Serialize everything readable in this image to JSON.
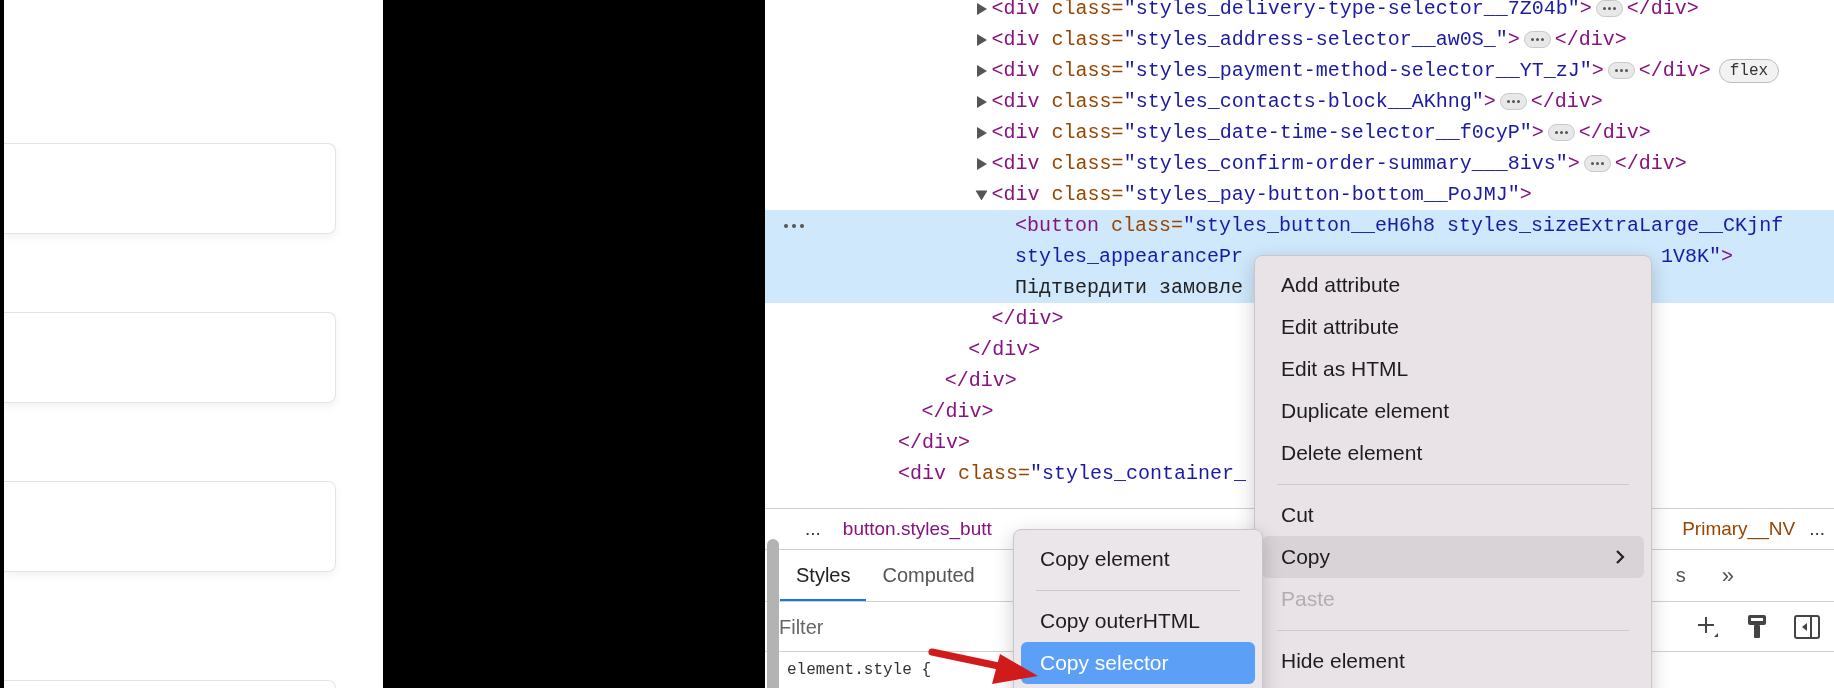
{
  "elements_tree": {
    "nodes": [
      {
        "children": [
          {
            "children": [
              {
                "children": [
                  {
                    "children": [
                      {
                        "selected": false,
                        "expanded": false,
                        "open": [
                          {
                            "kind": "tag",
                            "text": "<div"
                          },
                          {
                            "kind": "attr",
                            "text": " class="
                          },
                          {
                            "kind": "value",
                            "text": "\"styles_delivery-type-selector__7Z04b\""
                          },
                          {
                            "kind": "tag",
                            "text": ">"
                          }
                        ],
                        "ellipsis": true,
                        "tail": [
                          {
                            "kind": "tag",
                            "text": "</div>"
                          }
                        ]
                      },
                      {
                        "selected": false,
                        "expanded": false,
                        "open": [
                          {
                            "kind": "tag",
                            "text": "<div"
                          },
                          {
                            "kind": "attr",
                            "text": " class="
                          },
                          {
                            "kind": "value",
                            "text": "\"styles_address-selector__aw0S_\""
                          },
                          {
                            "kind": "tag",
                            "text": ">"
                          }
                        ],
                        "ellipsis": true,
                        "tail": [
                          {
                            "kind": "tag",
                            "text": "</div>"
                          }
                        ]
                      },
                      {
                        "selected": false,
                        "expanded": false,
                        "open": [
                          {
                            "kind": "tag",
                            "text": "<div"
                          },
                          {
                            "kind": "attr",
                            "text": " class="
                          },
                          {
                            "kind": "value",
                            "text": "\"styles_payment-method-selector__YT_zJ\""
                          },
                          {
                            "kind": "tag",
                            "text": ">"
                          }
                        ],
                        "ellipsis": true,
                        "tail": [
                          {
                            "kind": "tag",
                            "text": "</div>"
                          }
                        ],
                        "badge": "flex"
                      },
                      {
                        "selected": false,
                        "expanded": false,
                        "open": [
                          {
                            "kind": "tag",
                            "text": "<div"
                          },
                          {
                            "kind": "attr",
                            "text": " class="
                          },
                          {
                            "kind": "value",
                            "text": "\"styles_contacts-block__AKhng\""
                          },
                          {
                            "kind": "tag",
                            "text": ">"
                          }
                        ],
                        "ellipsis": true,
                        "tail": [
                          {
                            "kind": "tag",
                            "text": "</div>"
                          }
                        ]
                      },
                      {
                        "selected": false,
                        "expanded": false,
                        "open": [
                          {
                            "kind": "tag",
                            "text": "<div"
                          },
                          {
                            "kind": "attr",
                            "text": " class="
                          },
                          {
                            "kind": "value",
                            "text": "\"styles_date-time-selector__f0cyP\""
                          },
                          {
                            "kind": "tag",
                            "text": ">"
                          }
                        ],
                        "ellipsis": true,
                        "tail": [
                          {
                            "kind": "tag",
                            "text": "</div>"
                          }
                        ]
                      },
                      {
                        "selected": false,
                        "expanded": false,
                        "open": [
                          {
                            "kind": "tag",
                            "text": "<div"
                          },
                          {
                            "kind": "attr",
                            "text": " class="
                          },
                          {
                            "kind": "value",
                            "text": "\"styles_confirm-order-summary___8ivs\""
                          },
                          {
                            "kind": "tag",
                            "text": ">"
                          }
                        ],
                        "ellipsis": true,
                        "tail": [
                          {
                            "kind": "tag",
                            "text": "</div>"
                          }
                        ]
                      },
                      {
                        "selected": false,
                        "expanded": true,
                        "open": [
                          {
                            "kind": "tag",
                            "text": "<div"
                          },
                          {
                            "kind": "attr",
                            "text": " class="
                          },
                          {
                            "kind": "value",
                            "text": "\"styles_pay-button-bottom__PoJMJ\""
                          },
                          {
                            "kind": "tag",
                            "text": ">"
                          }
                        ],
                        "children": [
                          {
                            "selected": true,
                            "lines": [
                              [
                                {
                                  "kind": "tag",
                                  "text": "<button"
                                },
                                {
                                  "kind": "attr",
                                  "text": " class="
                                },
                                {
                                  "kind": "value",
                                  "text": "\"styles_button__eH6h8 styles_sizeExtraLarge__CKjnf"
                                }
                              ],
                              [
                                {
                                  "kind": "value",
                                  "text": "styles_appearancePr"
                                },
                                {
                                  "kind": "gap"
                                },
                                {
                                  "kind": "value",
                                  "text": "1V8K\""
                                },
                                {
                                  "kind": "tag",
                                  "text": ">"
                                }
                              ],
                              [
                                {
                                  "kind": "text",
                                  "text": "Підтвердити замовле"
                                }
                              ]
                            ]
                          }
                        ],
                        "close": [
                          {
                            "kind": "tag",
                            "text": "</div>"
                          }
                        ]
                      }
                    ],
                    "close": [
                      {
                        "kind": "tag",
                        "text": "</div>"
                      }
                    ]
                  }
                ],
                "close": [
                  {
                    "kind": "tag",
                    "text": "</div>"
                  }
                ]
              }
            ],
            "close": [
              {
                "kind": "tag",
                "text": "</div>"
              }
            ]
          }
        ],
        "close": [
          {
            "kind": "tag",
            "text": "</div>"
          }
        ]
      },
      {
        "selected": false,
        "open": [
          {
            "kind": "tag",
            "text": "<div"
          },
          {
            "kind": "attr",
            "text": " class="
          },
          {
            "kind": "value",
            "text": "\"styles_container_"
          }
        ]
      }
    ]
  },
  "breadcrumbs": {
    "overflow_left": "...",
    "start": "button.styles_butt",
    "end": "Primary__NV",
    "overflow_right": "..."
  },
  "tabs": [
    {
      "label": "Styles",
      "selected": true
    },
    {
      "label": "Computed",
      "selected": false
    },
    {
      "label": "s",
      "selected": false
    }
  ],
  "more_tabs": "»",
  "filter": {
    "placeholder": "Filter"
  },
  "style_rule": "element.style {",
  "context_menu": [
    {
      "kind": "item",
      "label": "Add attribute",
      "selected": false,
      "disabled": false
    },
    {
      "kind": "item",
      "label": "Edit attribute",
      "selected": false,
      "disabled": false
    },
    {
      "kind": "item",
      "label": "Edit as HTML",
      "selected": false,
      "disabled": false
    },
    {
      "kind": "item",
      "label": "Duplicate element",
      "selected": false,
      "disabled": false
    },
    {
      "kind": "item",
      "label": "Delete element",
      "selected": false,
      "disabled": false
    },
    {
      "kind": "separator"
    },
    {
      "kind": "item",
      "label": "Cut",
      "selected": false,
      "disabled": false
    },
    {
      "kind": "submenu",
      "label": "Copy",
      "selected": true,
      "disabled": false
    },
    {
      "kind": "item",
      "label": "Paste",
      "selected": false,
      "disabled": true
    },
    {
      "kind": "separator"
    },
    {
      "kind": "item",
      "label": "Hide element",
      "selected": false,
      "disabled": false
    }
  ],
  "copy_submenu": [
    {
      "kind": "item",
      "label": "Copy element",
      "selected": false
    },
    {
      "kind": "separator"
    },
    {
      "kind": "item",
      "label": "Copy outerHTML",
      "selected": false
    },
    {
      "kind": "item",
      "label": "Copy selector",
      "selected": true
    }
  ]
}
